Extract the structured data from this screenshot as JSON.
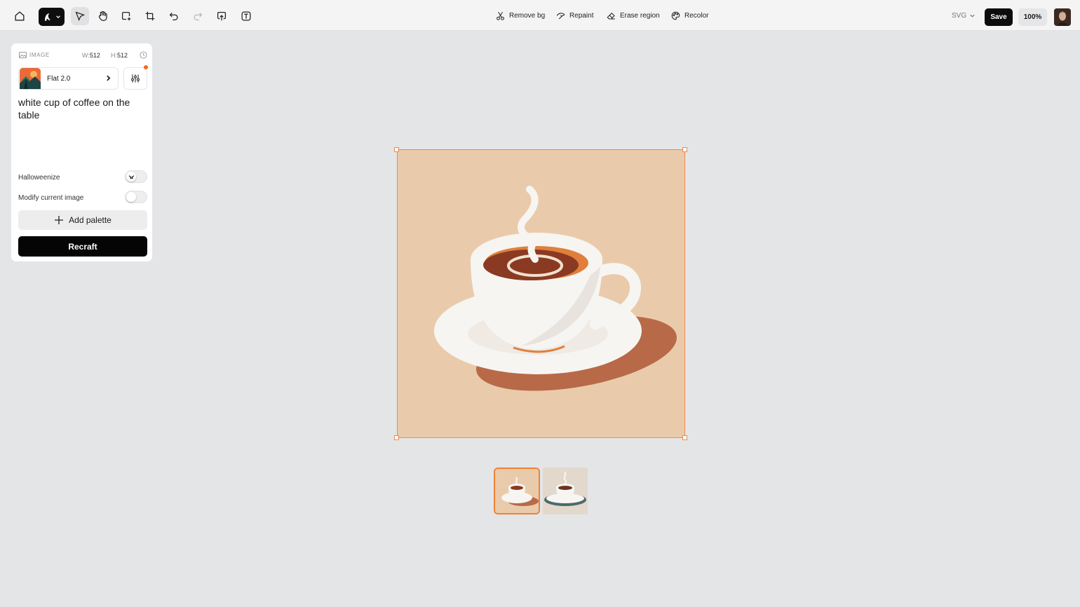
{
  "toolbar": {
    "tools": [
      {
        "name": "home",
        "icon": "home-icon"
      },
      {
        "name": "logo-menu",
        "icon": "recraft-logo-icon"
      },
      {
        "name": "select",
        "icon": "cursor-icon"
      },
      {
        "name": "hand",
        "icon": "hand-icon"
      },
      {
        "name": "frame-add",
        "icon": "frame-add-icon"
      },
      {
        "name": "crop",
        "icon": "crop-icon"
      },
      {
        "name": "undo",
        "icon": "undo-icon"
      },
      {
        "name": "redo",
        "icon": "redo-icon"
      },
      {
        "name": "upload",
        "icon": "upload-icon"
      },
      {
        "name": "text",
        "icon": "text-icon"
      }
    ],
    "ai_tools": [
      {
        "label": "Remove bg",
        "icon": "scissors-icon"
      },
      {
        "label": "Repaint",
        "icon": "repaint-icon"
      },
      {
        "label": "Erase region",
        "icon": "eraser-icon"
      },
      {
        "label": "Recolor",
        "icon": "palette-icon"
      }
    ],
    "export_format": "SVG",
    "save_label": "Save",
    "zoom_label": "100%"
  },
  "panel": {
    "type_label": "IMAGE",
    "width_label": "W:",
    "width_value": "512",
    "height_label": "H:",
    "height_value": "512",
    "style_name": "Flat 2.0",
    "prompt": "white cup of coffee on the table",
    "toggles": [
      {
        "label": "Halloweenize",
        "on": false
      },
      {
        "label": "Modify current image",
        "on": false
      }
    ],
    "add_palette_label": "Add palette",
    "recraft_label": "Recraft"
  },
  "colors": {
    "accent": "#ef8233",
    "artboard_bg": "#e9cbab",
    "shadow": "#b86a48",
    "coffee": "#8a3a22",
    "crema": "#e07f3c",
    "cup": "#f7f5f2"
  },
  "variants": [
    {
      "selected": true
    },
    {
      "selected": false
    }
  ]
}
